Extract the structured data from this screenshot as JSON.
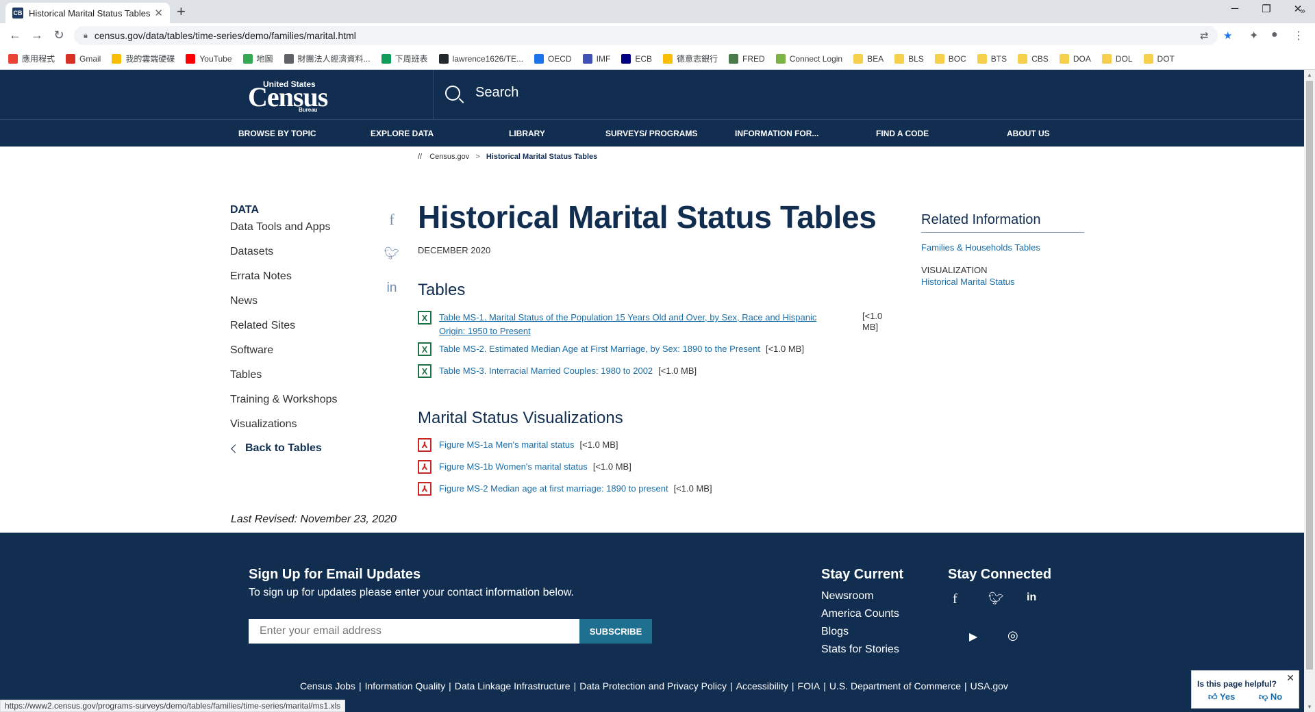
{
  "browser": {
    "tab_title": "Historical Marital Status Tables",
    "tab_favicon": "CB",
    "url": "census.gov/data/tables/time-series/demo/families/marital.html",
    "bookmarks": [
      {
        "label": "應用程式",
        "color": "#ea4335"
      },
      {
        "label": "Gmail",
        "color": "#d93025"
      },
      {
        "label": "我的雲端硬碟",
        "color": "#fbbc04"
      },
      {
        "label": "YouTube",
        "color": "#ff0000"
      },
      {
        "label": "地圖",
        "color": "#34a853"
      },
      {
        "label": "財團法人經濟資料...",
        "color": "#5f6368"
      },
      {
        "label": "下周班表",
        "color": "#0f9d58"
      },
      {
        "label": "lawrence1626/TE...",
        "color": "#24292e"
      },
      {
        "label": "OECD",
        "color": "#1a73e8"
      },
      {
        "label": "IMF",
        "color": "#3f51b5"
      },
      {
        "label": "ECB",
        "color": "#000080"
      },
      {
        "label": "德意志銀行",
        "color": "#fbbc04"
      },
      {
        "label": "FRED",
        "color": "#4a7a4a"
      },
      {
        "label": "Connect Login",
        "color": "#7cb342"
      },
      {
        "label": "BEA",
        "color": "#f6d04d"
      },
      {
        "label": "BLS",
        "color": "#f6d04d"
      },
      {
        "label": "BOC",
        "color": "#f6d04d"
      },
      {
        "label": "BTS",
        "color": "#f6d04d"
      },
      {
        "label": "CBS",
        "color": "#f6d04d"
      },
      {
        "label": "DOA",
        "color": "#f6d04d"
      },
      {
        "label": "DOL",
        "color": "#f6d04d"
      },
      {
        "label": "DOT",
        "color": "#f6d04d"
      }
    ],
    "more_bookmarks": "»",
    "status_url": "https://www2.census.gov/programs-surveys/demo/tables/families/time-series/marital/ms1.xls"
  },
  "header": {
    "logo_top": "United States",
    "logo_main": "Census",
    "logo_bottom": "Bureau",
    "search_label": "Search"
  },
  "nav": [
    "BROWSE BY TOPIC",
    "EXPLORE DATA",
    "LIBRARY",
    "SURVEYS/ PROGRAMS",
    "INFORMATION FOR...",
    "FIND A CODE",
    "ABOUT US"
  ],
  "breadcrumb": {
    "prefix": "//",
    "home": "Census.gov",
    "sep": ">",
    "current": "Historical Marital Status Tables"
  },
  "sidenav": {
    "head": "DATA",
    "items": [
      "Data Tools and Apps",
      "Datasets",
      "Errata Notes",
      "News",
      "Related Sites",
      "Software",
      "Tables",
      "Training & Workshops",
      "Visualizations"
    ],
    "back": "Back to Tables"
  },
  "main": {
    "title": "Historical Marital Status Tables",
    "date": "DECEMBER 2020",
    "tables_heading": "Tables",
    "tables": [
      {
        "line1": "Table MS-1. Marital Status of the Population 15 Years Old and Over, by Sex, Race and Hispanic",
        "line2": "Origin: 1950 to Present",
        "size1": "[<1.0",
        "size2": "MB]"
      },
      {
        "label": "Table MS-2. Estimated Median Age at First Marriage, by Sex: 1890 to the Present",
        "size": "[<1.0 MB]"
      },
      {
        "label": "Table MS-3. Interracial Married Couples: 1980 to 2002",
        "size": "[<1.0 MB]"
      }
    ],
    "viz_heading": "Marital Status Visualizations",
    "figures": [
      {
        "label": "Figure MS-1a Men's marital status",
        "size": "[<1.0 MB]"
      },
      {
        "label": "Figure MS-1b Women's marital status",
        "size": "[<1.0 MB]"
      },
      {
        "label": "Figure MS-2 Median age at first marriage: 1890 to present",
        "size": "[<1.0 MB]"
      }
    ],
    "last_revised": "Last Revised: November 23, 2020"
  },
  "related": {
    "heading": "Related Information",
    "link1": "Families & Households Tables",
    "label": "VISUALIZATION",
    "link2": "Historical Marital Status"
  },
  "footer": {
    "signup_title": "Sign Up for Email Updates",
    "signup_sub": "To sign up for updates please enter your contact information below.",
    "email_placeholder": "Enter your email address",
    "subscribe": "SUBSCRIBE",
    "stay_current": "Stay Current",
    "current_links": [
      "Newsroom",
      "America Counts",
      "Blogs",
      "Stats for Stories"
    ],
    "stay_connected": "Stay Connected",
    "bottom_links": [
      "Census Jobs",
      "Information Quality",
      "Data Linkage Infrastructure",
      "Data Protection and Privacy Policy",
      "Accessibility",
      "FOIA",
      "U.S. Department of Commerce",
      "USA.gov"
    ]
  },
  "helpful": {
    "question": "Is this page helpful?",
    "yes": "Yes",
    "no": "No"
  },
  "colors": {
    "census_navy": "#112e51",
    "link": "#1a6ea8",
    "excel_green": "#1e7145",
    "pdf_red": "#c62828"
  }
}
